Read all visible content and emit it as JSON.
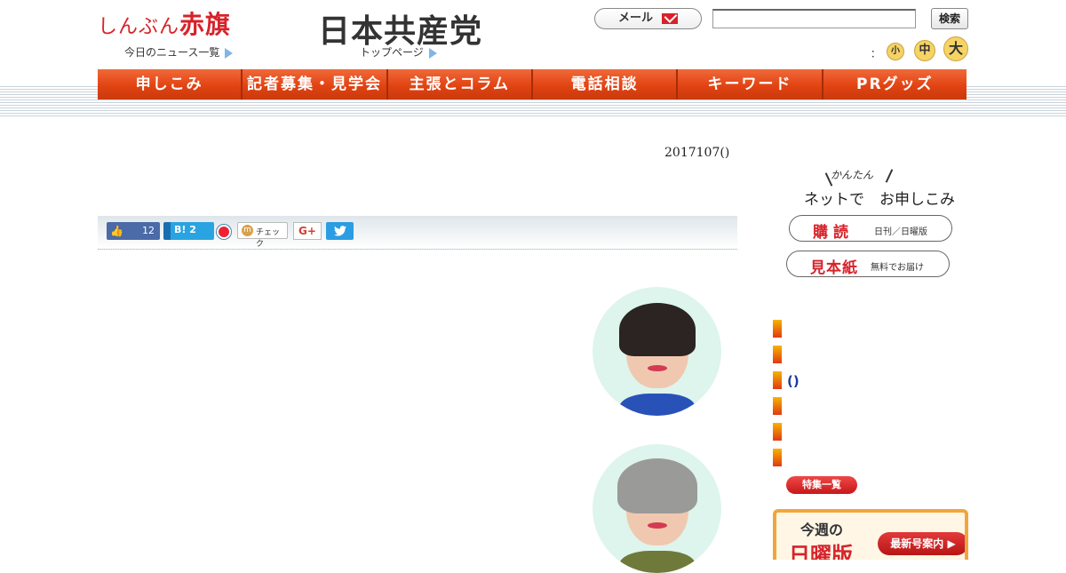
{
  "header": {
    "akahata_logo_small": "しんぶん",
    "akahata_logo_big": "赤旗",
    "news_list_label": "今日のニュース一覧",
    "jcp_logo": "日本共産党",
    "top_page_label": "トップページ",
    "mail_label": "メール",
    "search_value": "",
    "search_button": "検索",
    "font_size_label": "：",
    "font_small": "小",
    "font_medium": "中",
    "font_large": "大"
  },
  "nav": {
    "items": [
      "申しこみ",
      "記者募集・見学会",
      "主張とコラム",
      "電話相談",
      "キーワード",
      "PRグッズ"
    ]
  },
  "article": {
    "date": "2017107()"
  },
  "share": {
    "like_count": "12",
    "hatena_label": "B! 2",
    "mixi_label": "チェック",
    "gplus_label": "G+"
  },
  "sidebar": {
    "kantan": "かんたん",
    "net_apply": "ネットで　お申しこみ",
    "subscribe_main": "購読",
    "subscribe_sub": "日刊／日曜版",
    "sample_main": "見本紙",
    "sample_sub": "無料でお届け",
    "features": [
      "",
      "",
      "()",
      "",
      "",
      ""
    ],
    "feature_all": "特集一覧",
    "this_week": "今週の",
    "sunday_edition": "日曜版",
    "latest_issue": "最新号案内 ▶"
  },
  "colors": {
    "brand_red": "#d7222a",
    "nav_orange": "#e24312",
    "link_blue": "#1b3a9a"
  }
}
